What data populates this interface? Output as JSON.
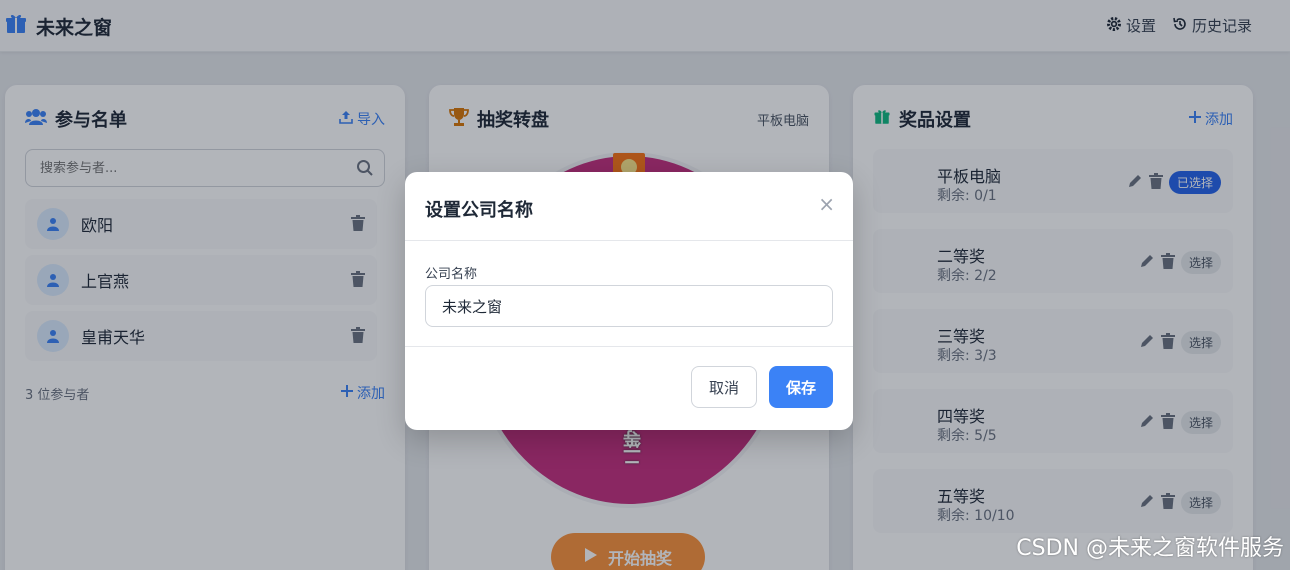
{
  "header": {
    "app_title": "未来之窗",
    "settings_label": "设置",
    "history_label": "历史记录"
  },
  "participants": {
    "title": "参与名单",
    "import_label": "导入",
    "search_placeholder": "搜索参与者...",
    "items": [
      {
        "name": "欧阳"
      },
      {
        "name": "上官燕"
      },
      {
        "name": "皇甫天华"
      }
    ],
    "count_text": "3 位参与者",
    "add_label": "添加"
  },
  "wheel": {
    "title": "抽奖转盘",
    "current_prize": "平板电脑",
    "segment_label": "二等奖",
    "start_label": "开始抽奖"
  },
  "prizes": {
    "title": "奖品设置",
    "add_label": "添加",
    "items": [
      {
        "name": "平板电脑",
        "remaining": "剩余: 0/1",
        "select_label": "已选择"
      },
      {
        "name": "二等奖",
        "remaining": "剩余: 2/2",
        "select_label": "选择"
      },
      {
        "name": "三等奖",
        "remaining": "剩余: 3/3",
        "select_label": "选择"
      },
      {
        "name": "四等奖",
        "remaining": "剩余: 5/5",
        "select_label": "选择"
      },
      {
        "name": "五等奖",
        "remaining": "剩余: 10/10",
        "select_label": "选择"
      }
    ]
  },
  "modal": {
    "title": "设置公司名称",
    "close_symbol": "×",
    "field_label": "公司名称",
    "field_value": "未来之窗",
    "cancel_label": "取消",
    "save_label": "保存"
  },
  "watermark": "CSDN @未来之窗软件服务",
  "colors": {
    "accent": "#3b82f6",
    "wheel": "#c42e7e",
    "start_button": "#fb923c",
    "overlay": "rgba(17,24,39,0.32)"
  }
}
